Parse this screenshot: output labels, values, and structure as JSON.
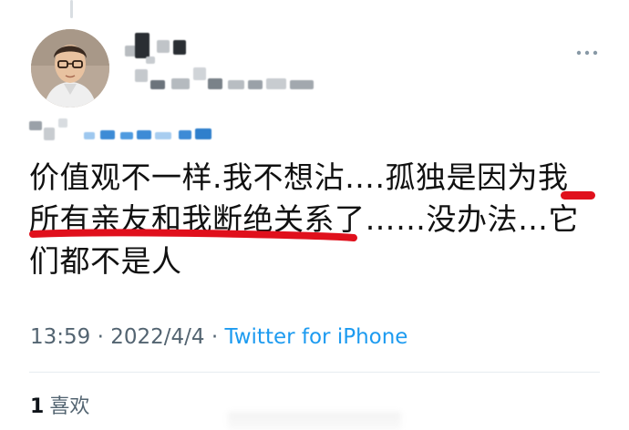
{
  "tweet": {
    "text_lines": [
      "价值观不一样.我不想沾….孤独是因为我",
      "所有亲友和我断绝关系了……没办法…它",
      "们都不是人"
    ],
    "time": "13:59",
    "separator": " · ",
    "date": "2022/4/4",
    "source": "Twitter for iPhone"
  },
  "engagement": {
    "likes_count": "1",
    "likes_label": "喜欢"
  },
  "icons": {
    "more": "more-dots-icon",
    "avatar": "avatar"
  },
  "colors": {
    "text": "#111111",
    "meta": "#536471",
    "link": "#1d9bf0",
    "annotation": "#e0101c"
  }
}
